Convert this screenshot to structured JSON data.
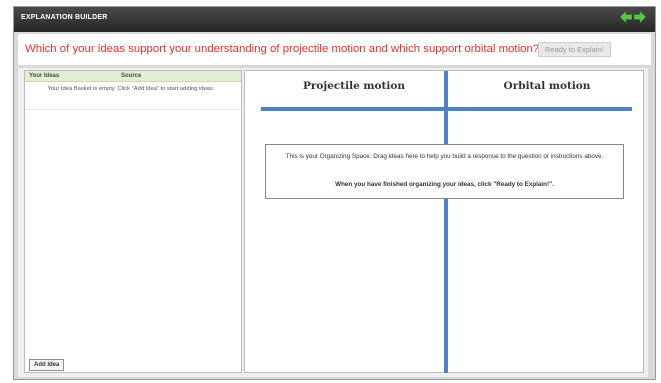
{
  "window": {
    "title": "EXPLANATION BUILDER"
  },
  "nav": {
    "back_icon": "arrow-left-icon",
    "forward_icon": "arrow-right-icon",
    "icon_color": "#5cc24a"
  },
  "question": {
    "text": "Which of your ideas support your understanding of projectile motion and which support orbital motion?",
    "color": "#e8312a"
  },
  "ready_button": {
    "label": "Ready to Explain!"
  },
  "idea_basket": {
    "columns": [
      "Your Ideas",
      "Source"
    ],
    "empty_message": "Your Idea Basket is empty. Click \"Add Idea\" to start adding ideas.",
    "add_button_label": "Add Idea"
  },
  "organizing_space": {
    "columns": [
      "Projectile motion",
      "Orbital motion"
    ],
    "divider_color": "#4e80c9",
    "instructions": "This is your Organizing Space. Drag ideas here to help you build a response to the question or instructions above.",
    "finish_text": "When you have finished organizing your ideas, click \"Ready to Explain!\"."
  }
}
